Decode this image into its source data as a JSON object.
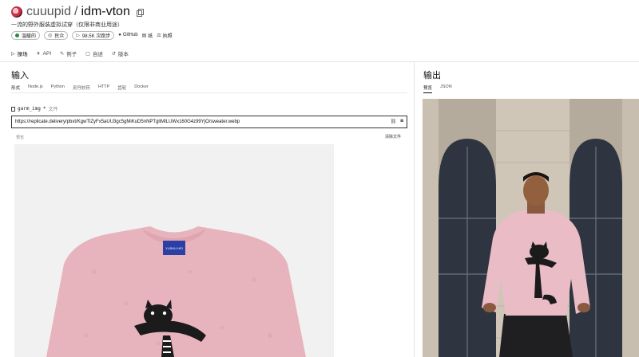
{
  "header": {
    "owner": "cuuupid",
    "separator": "/",
    "model": "idm-vton",
    "description": "一流的野外服装虚拟试穿（仅限非商业用途）"
  },
  "meta": {
    "status": "温暖的",
    "visibility": "民众",
    "runs": "98.5K 次跑步",
    "github": "GitHub",
    "paper": "纸",
    "license": "执照"
  },
  "tabs": [
    {
      "label": "操场",
      "icon": "play-icon"
    },
    {
      "label": "API",
      "icon": "rocket-icon"
    },
    {
      "label": "例子",
      "icon": "pencil-icon"
    },
    {
      "label": "自述",
      "icon": "file-icon"
    },
    {
      "label": "版本",
      "icon": "history-icon"
    }
  ],
  "input": {
    "heading": "输入",
    "subtabs": [
      "形式",
      "Node.js",
      "Python",
      "灵丹妙药",
      "HTTP",
      "齿轮",
      "Docker"
    ],
    "field_name": "garm_img",
    "field_required": "*",
    "field_type": "文件",
    "url": "https://replicate.delivery/pbxt/KgwTlZyFx5aUU3gc5gMiKuD5nNPTgliMILUWx160G4z99YjO/sweater.webp",
    "preview_label": "预览",
    "clear_label": "清除文件",
    "garment_tag": "YUSHU HEI"
  },
  "output": {
    "heading": "输出",
    "subtabs": [
      "预览",
      "JSON"
    ]
  }
}
